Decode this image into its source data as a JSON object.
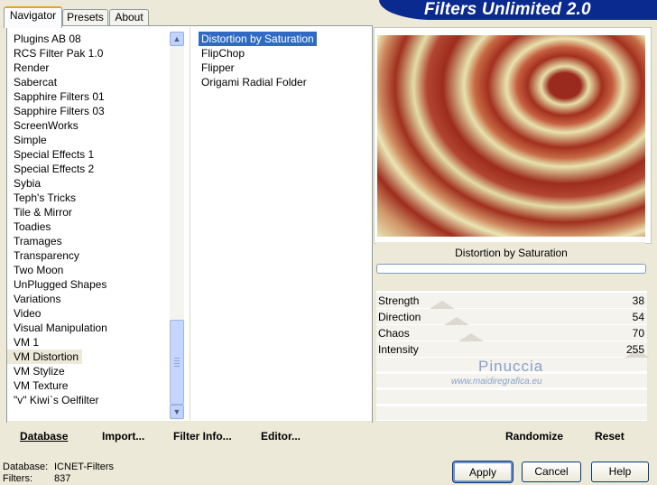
{
  "header": {
    "title": "Filters Unlimited 2.0"
  },
  "tabs": [
    {
      "label": "Navigator",
      "active": true
    },
    {
      "label": "Presets",
      "active": false
    },
    {
      "label": "About",
      "active": false
    }
  ],
  "categories": [
    "Plugins AB 08",
    "RCS Filter Pak 1.0",
    "Render",
    "Sabercat",
    "Sapphire Filters 01",
    "Sapphire Filters 03",
    "ScreenWorks",
    "Simple",
    "Special Effects 1",
    "Special Effects 2",
    "Sybia",
    "Teph's Tricks",
    "Tile & Mirror",
    "Toadies",
    "Tramages",
    "Transparency",
    "Two Moon",
    "UnPlugged Shapes",
    "Variations",
    "Video",
    "Visual Manipulation",
    "VM 1",
    "VM Distortion",
    "VM Stylize",
    "VM Texture",
    "\"v\" Kiwi`s Oelfilter"
  ],
  "selected_category": "VM Distortion",
  "filters": [
    "Distortion by Saturation",
    "FlipChop",
    "Flipper",
    "Origami Radial Folder"
  ],
  "selected_filter": "Distortion by Saturation",
  "nav_buttons": {
    "database": "Database",
    "import": "Import...",
    "filter_info": "Filter Info...",
    "editor": "Editor..."
  },
  "preview": {
    "filter_name": "Distortion by Saturation"
  },
  "sliders": [
    {
      "label": "Strength",
      "value": "38",
      "level": 38
    },
    {
      "label": "Direction",
      "value": "54",
      "level": 54
    },
    {
      "label": "Chaos",
      "value": "70",
      "level": 70
    },
    {
      "label": "Intensity",
      "value": "255",
      "level": 255
    }
  ],
  "watermark": {
    "name": "Pinuccia",
    "url": "www.maidiregrafica.eu"
  },
  "right_buttons": {
    "randomize": "Randomize",
    "reset": "Reset"
  },
  "status": {
    "database_label": "Database:",
    "database_value": "ICNET-Filters",
    "filters_label": "Filters:",
    "filters_value": "837"
  },
  "dialog_buttons": {
    "apply": "Apply",
    "cancel": "Cancel",
    "help": "Help"
  },
  "colors": {
    "selection": "#316ac5",
    "banner": "#0a2a8f",
    "face": "#ece9d8"
  }
}
